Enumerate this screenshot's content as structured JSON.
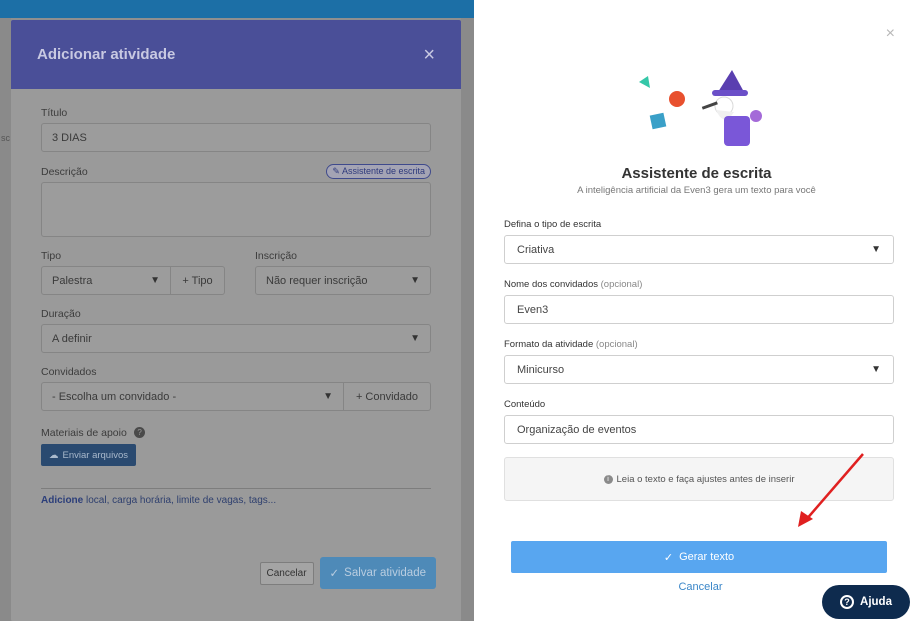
{
  "modal": {
    "title": "Adicionar atividade",
    "close": "×",
    "titulo_label": "Título",
    "titulo_value": "3 DIAS",
    "descricao_label": "Descrição",
    "assistente_badge": "Assistente de escrita",
    "tipo_label": "Tipo",
    "tipo_value": "Palestra",
    "tipo_add": "+ Tipo",
    "inscricao_label": "Inscrição",
    "inscricao_value": "Não requer inscrição",
    "duracao_label": "Duração",
    "duracao_value": "A definir",
    "convidados_label": "Convidados",
    "convidados_value": "- Escolha um convidado -",
    "convidado_add": "+ Convidado",
    "materiais_label": "Materiais de apoio",
    "upload_label": "Enviar arquivos",
    "more_bold": "Adicione",
    "more_rest": " local, carga horária, limite de vagas, tags...",
    "cancel_label": "Cancelar",
    "save_label": "Salvar atividade"
  },
  "panel": {
    "close": "×",
    "title": "Assistente de escrita",
    "subtitle": "A inteligência artificial da Even3 gera um texto para você",
    "tipo_escrita_label": "Defina o tipo de escrita",
    "tipo_escrita_value": "Criativa",
    "convidados_label": "Nome dos convidados",
    "convidados_opt": "(opcional)",
    "convidados_value": "Even3",
    "formato_label": "Formato da atividade",
    "formato_opt": "(opcional)",
    "formato_value": "Minicurso",
    "conteudo_label": "Conteúdo",
    "conteudo_value": "Organização de eventos",
    "note": "Leia o texto e faça ajustes antes de inserir",
    "generate_label": "Gerar texto",
    "cancel_label": "Cancelar"
  },
  "help": {
    "label": "Ajuda"
  },
  "colors": {
    "accent": "#58a6f0",
    "header": "#4a4f98",
    "help_bg": "#0e2b4e",
    "arrow": "#e02020"
  }
}
